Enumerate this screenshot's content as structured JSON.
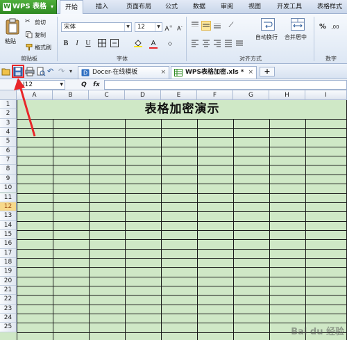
{
  "app": {
    "name": "WPS 表格",
    "logo": "W"
  },
  "menu_tabs": [
    "开始",
    "插入",
    "页面布局",
    "公式",
    "数据",
    "审阅",
    "视图",
    "开发工具",
    "表格样式"
  ],
  "active_tab": "开始",
  "ribbon": {
    "clipboard": {
      "paste": "粘贴",
      "cut": "剪切",
      "copy": "复制",
      "format_painter": "格式刷",
      "group": "剪贴板"
    },
    "font": {
      "name": "宋体",
      "size": "12",
      "group": "字体",
      "bold": "B",
      "italic": "I",
      "underline": "U"
    },
    "align": {
      "wrap": "自动换行",
      "merge": "合并居中",
      "group": "对齐方式"
    },
    "number": {
      "percent": "%",
      "group": "数字"
    }
  },
  "toolbar": {
    "tabs": [
      {
        "label": "Docer-在线模板",
        "close": "×"
      },
      {
        "label": "WPS表格加密.xls *",
        "close": "×"
      }
    ],
    "new_tab": "+"
  },
  "formula_bar": {
    "cell_ref": "I12",
    "fx": "fx",
    "zoom": "Q"
  },
  "sheet": {
    "columns": [
      "A",
      "B",
      "C",
      "D",
      "E",
      "F",
      "G",
      "H",
      "I"
    ],
    "rows": [
      "1",
      "2",
      "3",
      "4",
      "5",
      "6",
      "7",
      "8",
      "9",
      "10",
      "11",
      "12",
      "13",
      "14",
      "15",
      "16",
      "17",
      "18",
      "19",
      "20",
      "21",
      "22",
      "23",
      "24",
      "25"
    ],
    "selected_row": "12",
    "title": "表格加密演示"
  },
  "colors": {
    "highlight": "#e8262a",
    "grid_fill": "#cfe8c6",
    "accent_green": "#2e8a22"
  },
  "watermark": "Bai du 经验"
}
